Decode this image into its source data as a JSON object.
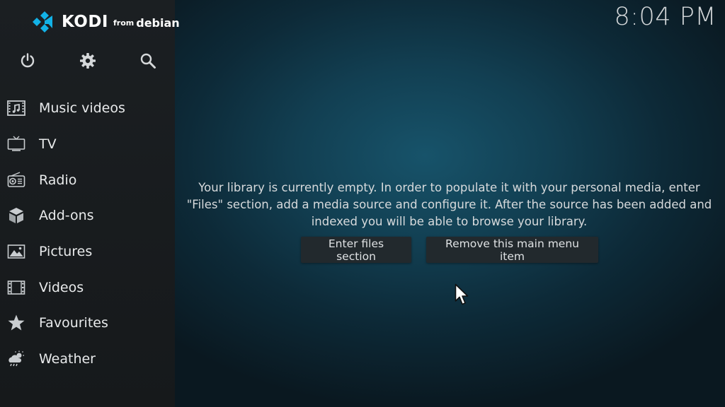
{
  "logo": {
    "word": "KODI",
    "from": "from",
    "distro": "debian"
  },
  "clock": "8:04 PM",
  "top_icons": [
    {
      "name": "power-icon"
    },
    {
      "name": "settings-icon"
    },
    {
      "name": "search-icon"
    }
  ],
  "menu": {
    "items": [
      {
        "label": "Music videos",
        "icon": "music-videos-icon"
      },
      {
        "label": "TV",
        "icon": "tv-icon"
      },
      {
        "label": "Radio",
        "icon": "radio-icon"
      },
      {
        "label": "Add-ons",
        "icon": "addons-icon"
      },
      {
        "label": "Pictures",
        "icon": "pictures-icon"
      },
      {
        "label": "Videos",
        "icon": "videos-icon"
      },
      {
        "label": "Favourites",
        "icon": "star-icon"
      },
      {
        "label": "Weather",
        "icon": "weather-icon"
      }
    ]
  },
  "main": {
    "message": "Your library is currently empty. In order to populate it with your personal media, enter \"Files\" section, add a media source and configure it. After the source has been added and indexed you will be able to browse your library.",
    "enter_files_label": "Enter files section",
    "remove_item_label": "Remove this main menu item"
  },
  "colors": {
    "accent": "#12b2e7",
    "sidebar_bg": "#1b1f22",
    "text": "#e8eaeb"
  }
}
